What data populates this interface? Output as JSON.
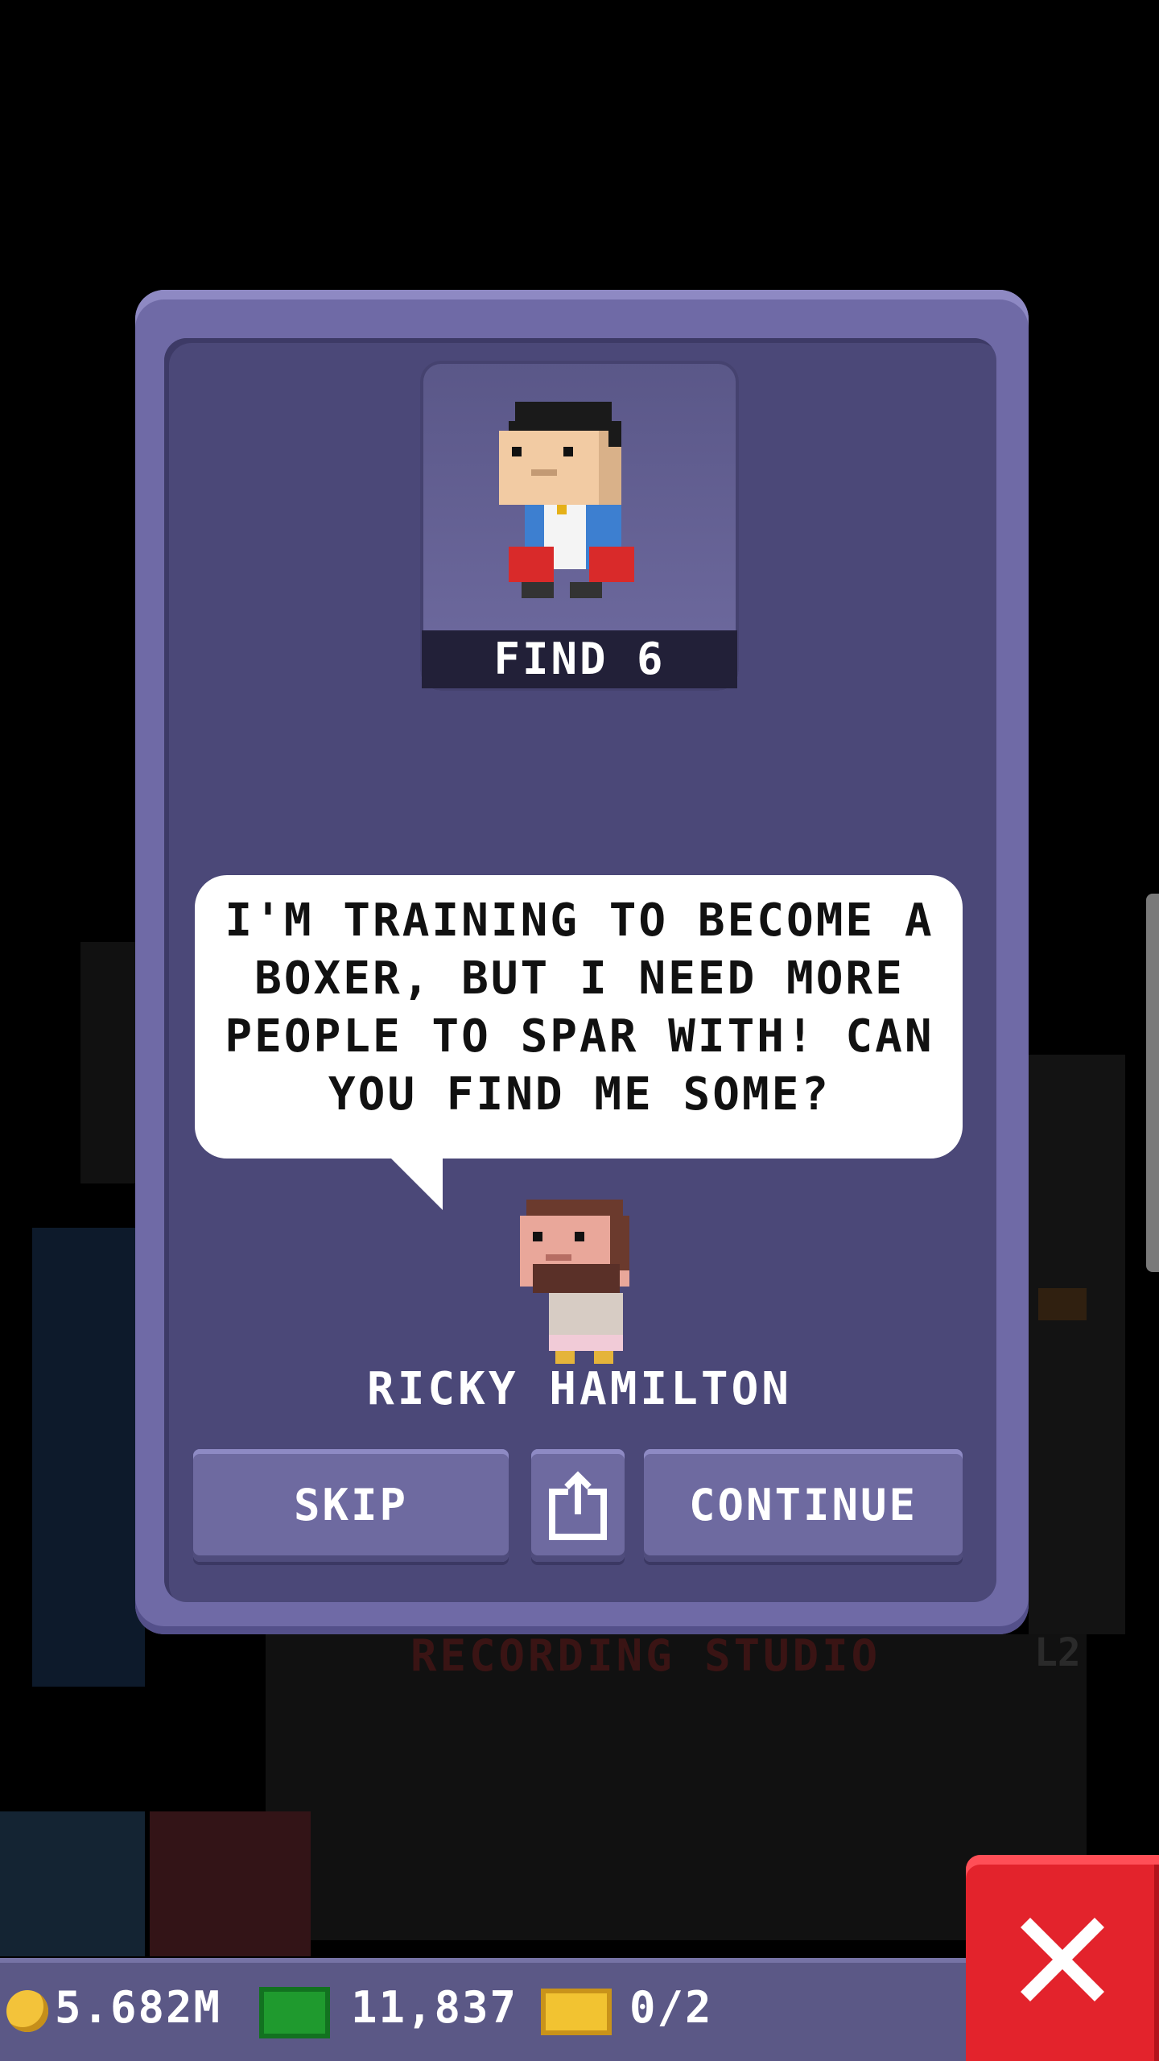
{
  "quest": {
    "find_label": "FIND 6",
    "dialogue": "I'M TRAINING TO BECOME A BOXER, BUT I NEED MORE PEOPLE TO SPAR WITH! CAN YOU FIND ME SOME?",
    "character_name": "RICKY HAMILTON"
  },
  "buttons": {
    "skip": "SKIP",
    "continue": "CONTINUE",
    "share_icon": "share-icon"
  },
  "bottom_bar": {
    "coins": "5.682M",
    "bux": "11,837",
    "tickets": "0/2"
  },
  "background": {
    "floor_label": "RECORDING STUDIO",
    "floor_level": "L2"
  },
  "colors": {
    "dialog": "#6f6aa6",
    "dialog_inner": "#4b4878",
    "close": "#e3232c"
  }
}
